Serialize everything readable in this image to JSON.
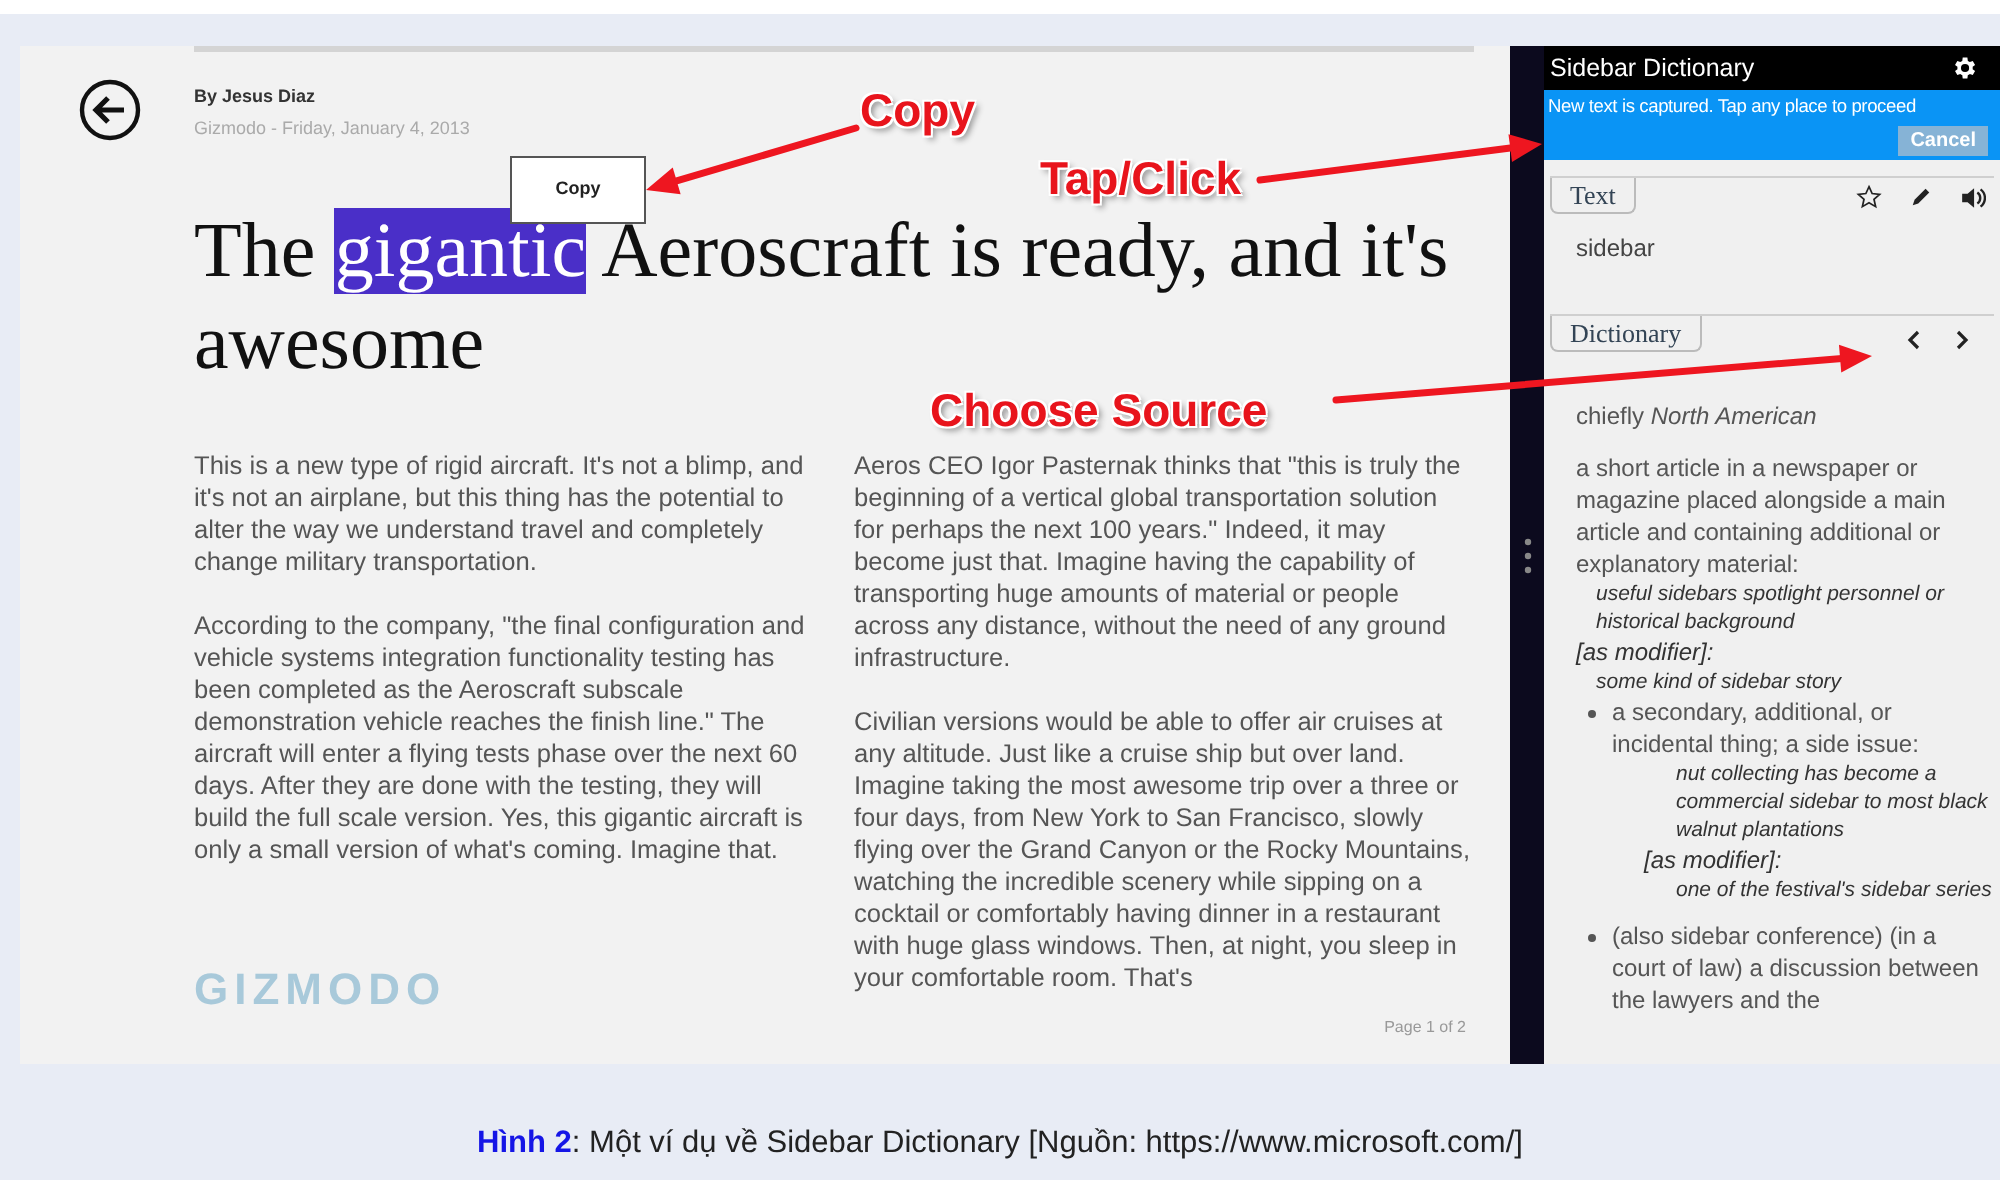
{
  "article": {
    "byline": "By Jesus Diaz",
    "source_line": "Gizmodo - Friday, January 4, 2013",
    "headline": {
      "before": "The ",
      "selected_word": "gigantic",
      "after": " Aeroscraft is ready, and it's awesome"
    },
    "columns": [
      [
        "This is a new type of rigid aircraft. It's not a blimp, and it's not an airplane, but this thing has the potential to alter the way we understand travel and completely change military transportation.",
        "According to the company, \"the final configuration and vehicle systems integration functionality testing has been completed as the Aeroscraft subscale demonstration vehicle reaches the finish line.\" The aircraft will enter a flying tests phase over the next 60 days. After they are done with the testing, they will build the full scale version. Yes, this gigantic aircraft is only a small version of what's coming. Imagine that."
      ],
      [
        "Aeros CEO Igor Pasternak thinks that \"this is truly the beginning of a vertical global transportation solution for perhaps the next 100 years.\" Indeed, it may become just that. Imagine having the capability of transporting huge amounts of material or people across any distance, without the need of any ground infrastructure.",
        "Civilian versions would be able to offer air cruises at any altitude. Just like a cruise ship but over land. Imagine taking the most awesome trip over a three or four days, from New York to San Francisco, slowly flying over the Grand Canyon or the Rocky Mountains, watching the incredible scenery while sipping on a cocktail or comfortably having dinner in a restaurant with huge glass windows. Then, at night, you sleep in your comfortable room. That's"
      ]
    ],
    "logo": "GIZMODO",
    "page_indicator": "Page 1 of 2",
    "copy_popup": "Copy"
  },
  "sidebar": {
    "title": "Sidebar Dictionary",
    "notice": "New text is captured. Tap any place to proceed",
    "cancel_button": "Cancel",
    "text_tab": "Text",
    "captured_text": "sidebar",
    "dictionary_tab": "Dictionary",
    "entries": [
      {
        "kind": "region",
        "text": "chiefly *North American*"
      },
      {
        "kind": "definition",
        "text": "a short article in a newspaper or magazine placed alongside a main article and containing additional or explanatory material:"
      },
      {
        "kind": "example",
        "text": "useful sidebars spotlight personnel or historical background"
      },
      {
        "kind": "modifier",
        "text": "[as modifier]:"
      },
      {
        "kind": "example",
        "text": "some kind of sidebar story"
      },
      {
        "kind": "bullet",
        "text": "a secondary, additional, or incidental thing; a side issue:"
      },
      {
        "kind": "sub_example",
        "text": "nut collecting has become a commercial sidebar to most black walnut plantations"
      },
      {
        "kind": "sub_modifier",
        "text": "[as modifier]:"
      },
      {
        "kind": "sub_example",
        "text": "one of the festival's sidebar series"
      },
      {
        "kind": "bullet",
        "text": "(also sidebar conference) (in a court of law) a discussion between the lawyers and the"
      }
    ]
  },
  "annotations": [
    {
      "text": "Copy"
    },
    {
      "text": "Tap/Click"
    },
    {
      "text": "Choose Source"
    }
  ],
  "caption": "**Hình 2**: Một ví dụ về Sidebar Dictionary [Nguồn: https://www.microsoft.com/]"
}
